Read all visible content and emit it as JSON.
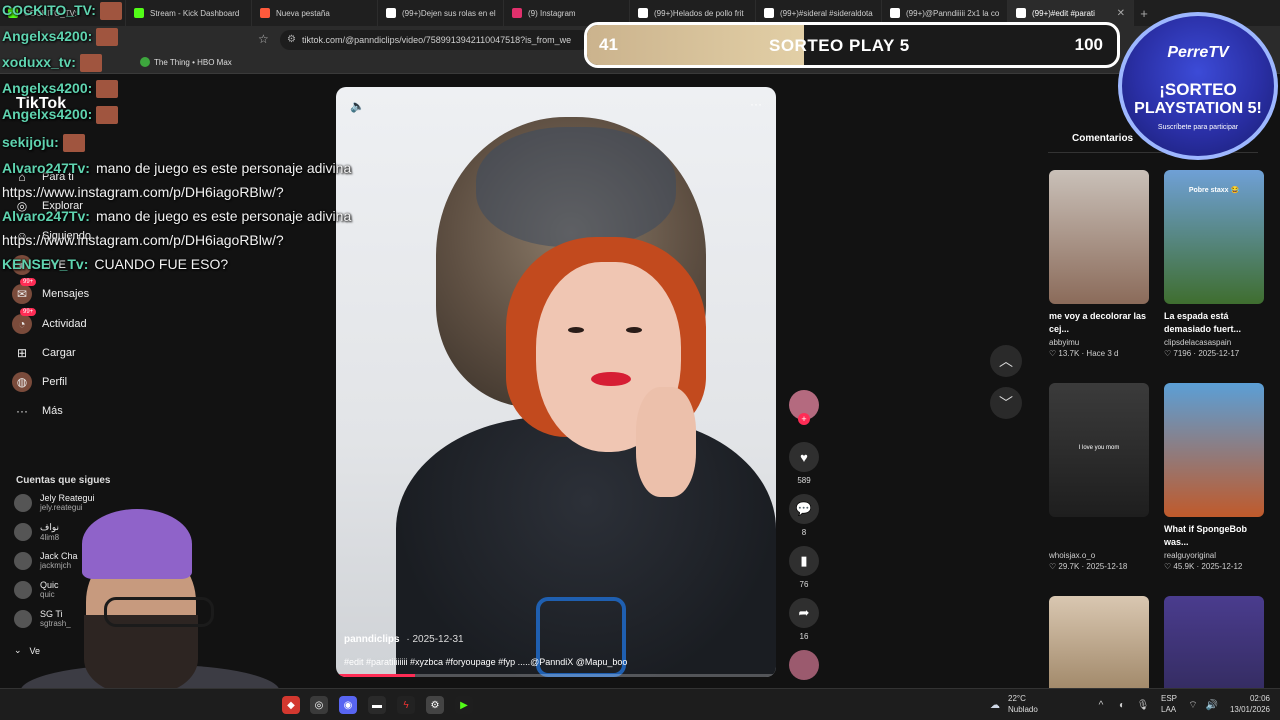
{
  "browser": {
    "tabs": [
      {
        "label": "COCKITO_TV:",
        "color": "#53fc18",
        "active": false
      },
      {
        "label": "Stream - Kick Dashboard",
        "color": "#53fc18",
        "active": false
      },
      {
        "label": "Nueva pestaña",
        "color": "#ff5a3c",
        "active": false
      },
      {
        "label": "(99+)Dejen sus rolas en el",
        "color": "#ffffff",
        "active": false
      },
      {
        "label": "(9) Instagram",
        "color": "#e1306c",
        "active": false
      },
      {
        "label": "(99+)Helados de pollo frit",
        "color": "#ffffff",
        "active": false
      },
      {
        "label": "(99+)#sideral #sideraldota",
        "color": "#ffffff",
        "active": false
      },
      {
        "label": "(99+)@Panndiiiii 2x1 la co",
        "color": "#ffffff",
        "active": false
      },
      {
        "label": "(99+)#edit #parati",
        "color": "#ffffff",
        "active": true
      }
    ],
    "url": "tiktok.com/@panndiclips/video/7589913942110047518?is_from_we",
    "bookmark": "The Thing • HBO Max"
  },
  "tiktok": {
    "logo": "TikTok",
    "nav": [
      {
        "label": "Para ti",
        "icon": "home-icon"
      },
      {
        "label": "Explorar",
        "icon": "compass-icon"
      },
      {
        "label": "Siguiendo",
        "icon": "people-icon"
      },
      {
        "label": "LIVE",
        "icon": "live-icon"
      },
      {
        "label": "Mensajes",
        "icon": "message-icon",
        "badge": "99+"
      },
      {
        "label": "Actividad",
        "icon": "activity-icon",
        "badge": "99+"
      },
      {
        "label": "Cargar",
        "icon": "upload-icon"
      },
      {
        "label": "Perfil",
        "icon": "profile-icon"
      },
      {
        "label": "Más",
        "icon": "more-icon"
      }
    ],
    "following_title": "Cuentas que sigues",
    "following": [
      {
        "name": "Jely Reategui",
        "handle": "jely.reategui"
      },
      {
        "name": "نواف",
        "handle": "4lim8"
      },
      {
        "name": "Jack Cha",
        "handle": "jackmjch"
      },
      {
        "name": "Quic",
        "handle": "quic"
      },
      {
        "name": "SG Ti",
        "handle": "sgtrash_"
      }
    ],
    "see_more": "Ve",
    "video": {
      "author": "panndiclips",
      "date": "2025-12-31",
      "description": "#edit #paratiiiiiiii #xyzbca #foryoupage #fyp .....@PanndiX @Mapu_boo",
      "progress": 0.18
    },
    "actions": {
      "likes": "589",
      "comments": "8",
      "saves": "76",
      "shares": "16"
    },
    "comments_tab": "Comentarios",
    "cards": [
      {
        "title": "me voy a decolorar las cej...",
        "user": "abbyimu",
        "likes": "13.7K",
        "date": "Hace 3 d",
        "c1": "#c9c0b8",
        "c2": "#8b6b5a"
      },
      {
        "title": "La espada está demasiado fuert...",
        "user": "clipsdelacasaspain",
        "likes": "7196",
        "date": "2025-12-17",
        "c1": "#6fa0d6",
        "c2": "#3f6e2f"
      },
      {
        "title": "",
        "user": "whoisjax.o_o",
        "likes": "29.7K",
        "date": "2025-12-18",
        "c1": "#3b3b3b",
        "c2": "#1e1e1e"
      },
      {
        "title": "What if SpongeBob was...",
        "user": "realguyoriginal",
        "likes": "45.9K",
        "date": "2025-12-12",
        "c1": "#5b9fd6",
        "c2": "#c05a2b"
      },
      {
        "title": "",
        "user": "",
        "likes": "",
        "date": "",
        "c1": "#d9c7b1",
        "c2": "#8a6f4c"
      },
      {
        "title": "",
        "user": "",
        "likes": "",
        "date": "",
        "c1": "#4a3c8e",
        "c2": "#2c2650"
      }
    ],
    "card_overlay_text": "Pobre staxx 😂",
    "card_caption_3": "I love you mom"
  },
  "stream": {
    "chat": [
      {
        "user": "COCKITO_TV:",
        "msg": ""
      },
      {
        "user": "Angelxs4200:",
        "msg": ""
      },
      {
        "user": "xoduxx_tv:",
        "msg": ""
      },
      {
        "user": "Angelxs4200:",
        "msg": ""
      },
      {
        "user": "Angelxs4200:",
        "msg": ""
      },
      {
        "user": "sekijoju:",
        "msg": ""
      },
      {
        "user": "Alvaro247Tv:",
        "msg": "mano de  juego es este personaje adivina"
      },
      {
        "user": "Alvaro247Tv:",
        "msg": "mano de  juego es este personaje adivina"
      },
      {
        "user": "KENSEY_Tv:",
        "msg": "CUANDO FUE ESO?"
      }
    ],
    "chat_url": "https://www.instagram.com/p/DH6iagoRBlw/?",
    "sorteo": {
      "left": "41",
      "title": "SORTEO PLAY 5",
      "right": "100",
      "fill": 0.41
    },
    "promo": {
      "brand": "PerreTV",
      "line1": "¡SORTEO",
      "line2": "PLAYSTATION 5!",
      "sub": "Suscríbete para participar"
    }
  },
  "taskbar": {
    "weather_temp": "22°C",
    "weather_desc": "Nublado",
    "lang": "ESP",
    "lang_sub": "LAA",
    "time": "02:06",
    "date": "13/01/2026"
  }
}
